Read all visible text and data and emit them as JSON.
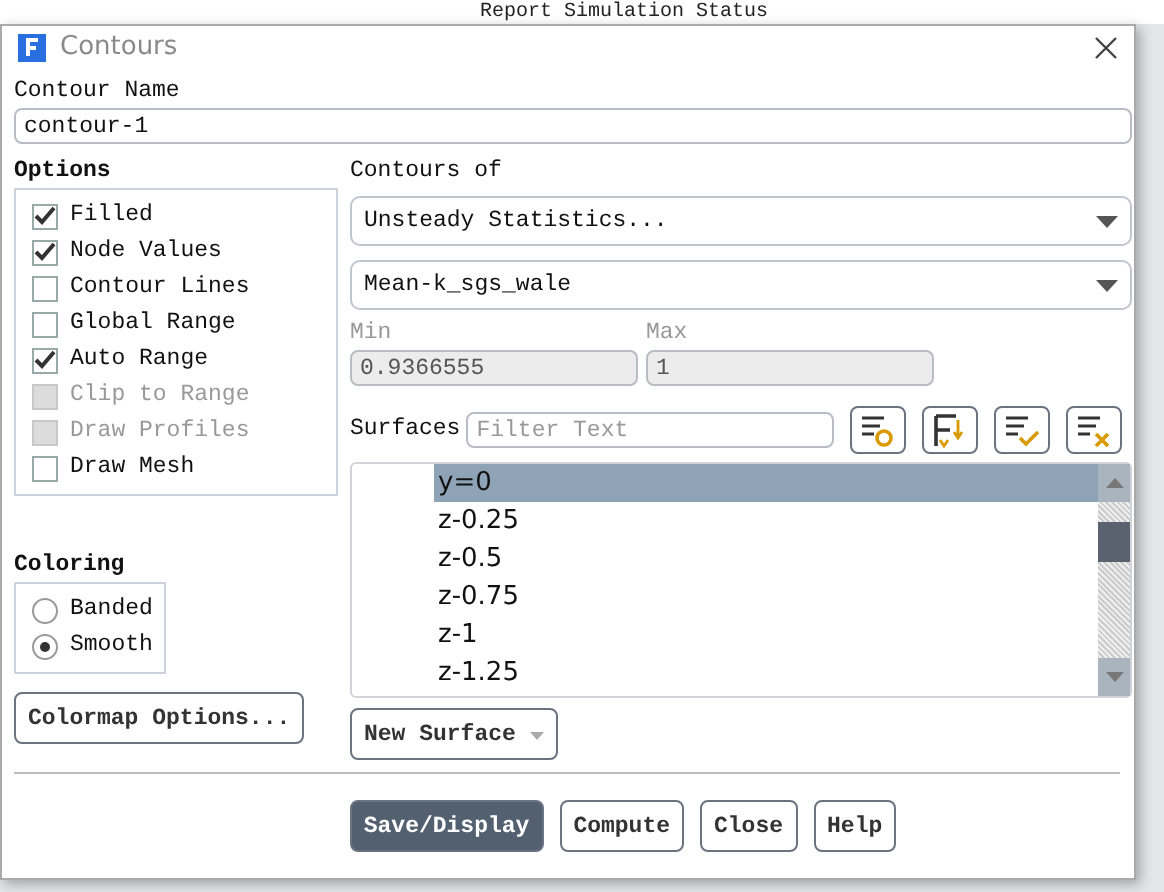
{
  "background": {
    "text": "Report Simulation Status"
  },
  "window": {
    "title": "Contours"
  },
  "contour_name": {
    "label": "Contour Name",
    "value": "contour-1"
  },
  "options": {
    "title": "Options",
    "items": [
      {
        "label": "Filled",
        "checked": true,
        "disabled": false
      },
      {
        "label": "Node Values",
        "checked": true,
        "disabled": false
      },
      {
        "label": "Contour Lines",
        "checked": false,
        "disabled": false
      },
      {
        "label": "Global Range",
        "checked": false,
        "disabled": false
      },
      {
        "label": "Auto Range",
        "checked": true,
        "disabled": false
      },
      {
        "label": "Clip to Range",
        "checked": false,
        "disabled": true
      },
      {
        "label": "Draw Profiles",
        "checked": false,
        "disabled": true
      },
      {
        "label": "Draw Mesh",
        "checked": false,
        "disabled": false
      }
    ]
  },
  "coloring": {
    "title": "Coloring",
    "options": [
      {
        "label": "Banded",
        "selected": false
      },
      {
        "label": "Smooth",
        "selected": true
      }
    ]
  },
  "colormap_button": "Colormap Options...",
  "contours_of": {
    "label": "Contours of",
    "category": "Unsteady Statistics...",
    "variable": "Mean-k_sgs_wale"
  },
  "min": {
    "label": "Min",
    "value": "0.9366555"
  },
  "max": {
    "label": "Max",
    "value": "1"
  },
  "surfaces": {
    "label": "Surfaces",
    "placeholder": "Filter Text",
    "items": [
      {
        "label": "y=0",
        "selected": true
      },
      {
        "label": "z-0.25",
        "selected": false
      },
      {
        "label": "z-0.5",
        "selected": false
      },
      {
        "label": "z-0.75",
        "selected": false
      },
      {
        "label": "z-1",
        "selected": false
      },
      {
        "label": "z-1.25",
        "selected": false
      }
    ]
  },
  "new_surface_button": "New Surface",
  "buttons": [
    {
      "label": "Save/Display",
      "kind": "primary"
    },
    {
      "label": "Compute",
      "kind": "default"
    },
    {
      "label": "Close",
      "kind": "default"
    },
    {
      "label": "Help",
      "kind": "default"
    }
  ]
}
